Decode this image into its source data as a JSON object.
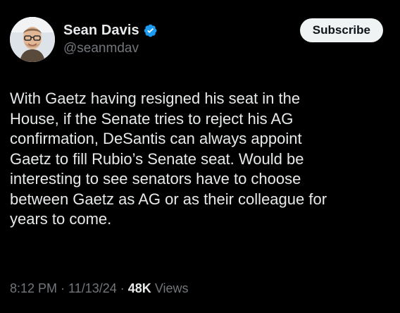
{
  "author": {
    "display_name": "Sean Davis",
    "handle": "@seanmdav",
    "verified": true,
    "verified_color": "#1d9bf0"
  },
  "actions": {
    "subscribe_label": "Subscribe"
  },
  "tweet": {
    "text": "With Gaetz having resigned his seat in the\nHouse, if the Senate tries to reject his AG\nconfirmation, DeSantis can always appoint\nGaetz to fill Rubio’s Senate seat. Would be\ninteresting to see senators have to choose\nbetween Gaetz as AG or as their colleague for\nyears to come."
  },
  "meta": {
    "time": "8:12 PM",
    "date": "11/13/24",
    "separator": "·",
    "views_count": "48K",
    "views_label": "Views"
  },
  "colors": {
    "background": "#000000",
    "primary_text": "#e7e9ea",
    "secondary_text": "#71767b",
    "button_bg": "#eff3f4"
  }
}
